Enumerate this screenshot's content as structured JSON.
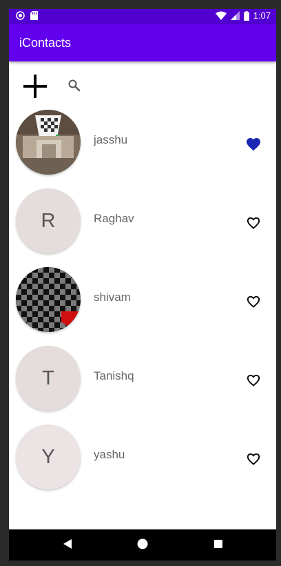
{
  "status_bar": {
    "time": "1:07",
    "left_icons": [
      "record-icon",
      "sd-card-icon"
    ],
    "right_icons": [
      "wifi-icon",
      "signal-icon",
      "battery-icon"
    ]
  },
  "app_bar": {
    "title": "iContacts",
    "color": "#6200ee"
  },
  "toolbar": {
    "add_icon": "plus-icon",
    "search_icon": "search-icon"
  },
  "contacts": [
    {
      "name": "jasshu",
      "initial": "",
      "avatar": "photo-room",
      "favorite": true
    },
    {
      "name": "Raghav",
      "initial": "R",
      "avatar": "letter",
      "favorite": false
    },
    {
      "name": "shivam",
      "initial": "",
      "avatar": "checkerboard",
      "favorite": false
    },
    {
      "name": "Tanishq",
      "initial": "T",
      "avatar": "letter",
      "favorite": false
    },
    {
      "name": "yashu",
      "initial": "Y",
      "avatar": "letter",
      "favorite": false
    }
  ],
  "colors": {
    "favorite_filled": "#1a28b4",
    "avatar_bg": "#e5dcdc"
  },
  "nav_bar": {
    "buttons": [
      "back-icon",
      "home-icon",
      "recents-icon"
    ]
  }
}
